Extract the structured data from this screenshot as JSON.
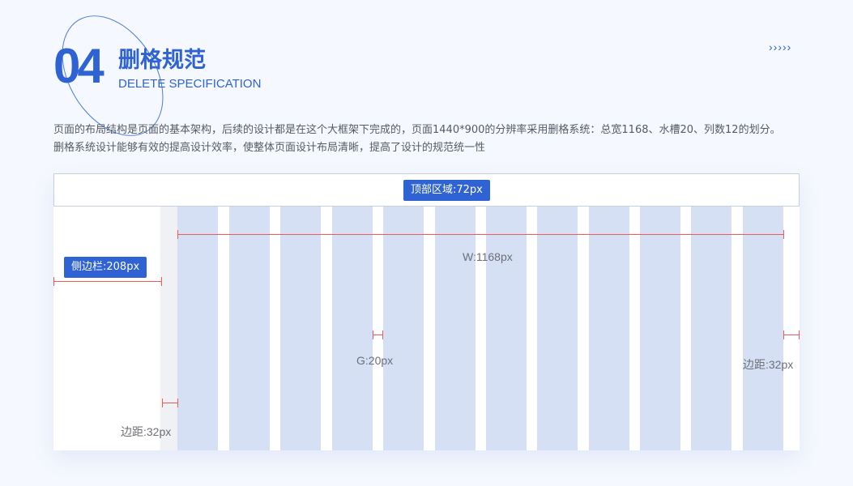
{
  "section": {
    "number": "04",
    "title": "删格规范",
    "subtitle": "DELETE SPECIFICATION",
    "arrows": "›››››"
  },
  "description": "页面的布局结构是页面的基本架构，后续的设计都是在这个大框架下完成的，页面1440*900的分辨率采用删格系统：总宽1168、水槽20、列数12的划分。删格系统设计能够有效的提高设计效率，使整体页面设计布局清晰，提高了设计的规范统一性",
  "diagram": {
    "header_tag": "顶部区域:72px",
    "sidebar_tag": "侧边栏:208px",
    "content_width_label": "W:1168px",
    "gutter_label": "G:20px",
    "right_margin_label": "边距:32px",
    "left_margin_label": "边距:32px",
    "column_count": 12
  },
  "colors": {
    "accent": "#2f63d3",
    "column": "#d6e0f5",
    "measure_line": "#ef5a5a",
    "background": "#f5f8fe"
  }
}
